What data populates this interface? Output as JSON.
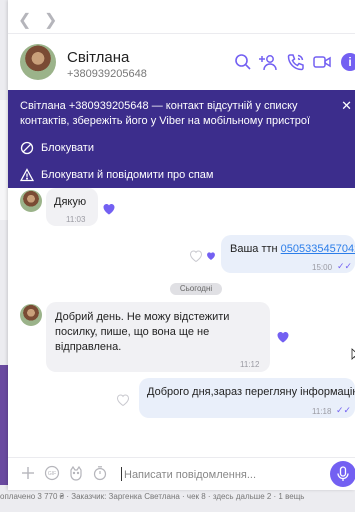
{
  "background": {
    "bottom_text": "оплачено 3 770 ₴ · Заказчик: Заргенка Светлана · чек 8 · здесь дальше 2 · 1 вещь"
  },
  "nav": {
    "back_icon": "chevron-left-icon",
    "forward_icon": "chevron-right-icon"
  },
  "header": {
    "name": "Світлана",
    "phone": "+380939205648",
    "icons": [
      "search-icon",
      "add-participant-icon",
      "call-icon",
      "video-call-icon",
      "info-icon"
    ],
    "info_glyph": "i"
  },
  "banner": {
    "text": "Світлана +380939205648 — контакт відсутній у списку контактів, збережіть його у Viber на мобільному пристрої",
    "close_glyph": "✕",
    "block_label": "Блокувати",
    "spam_label": "Блокувати й повідомити про спам"
  },
  "messages": [
    {
      "direction": "in",
      "text": "Дякую",
      "time": "11:03",
      "liked": true
    },
    {
      "direction": "out",
      "text_prefix": "Ваша ттн ",
      "link": "0505335457042",
      "time": "15:00",
      "ticks": "✓✓"
    },
    {
      "direction": "in",
      "text": "Добрий день. Не можу відстежити посилку, пише, що вона ще не відправлена.",
      "time": "11:12",
      "liked": true
    },
    {
      "direction": "out",
      "text": "Доброго дня,зараз перегляну інформацію",
      "time": "11:18",
      "ticks": "✓✓"
    }
  ],
  "date_separator": "Сьогодні",
  "composer": {
    "placeholder": "Написати повідомлення...",
    "icons": [
      "plus-icon",
      "gif-icon",
      "sticker-icon",
      "timer-icon",
      "mic-icon"
    ]
  },
  "colors": {
    "accent": "#7360f2",
    "banner_bg": "#3c2d8c",
    "incoming_bubble": "#f1f1f4",
    "outgoing_bubble": "#e9effa",
    "link": "#2b7de9"
  }
}
